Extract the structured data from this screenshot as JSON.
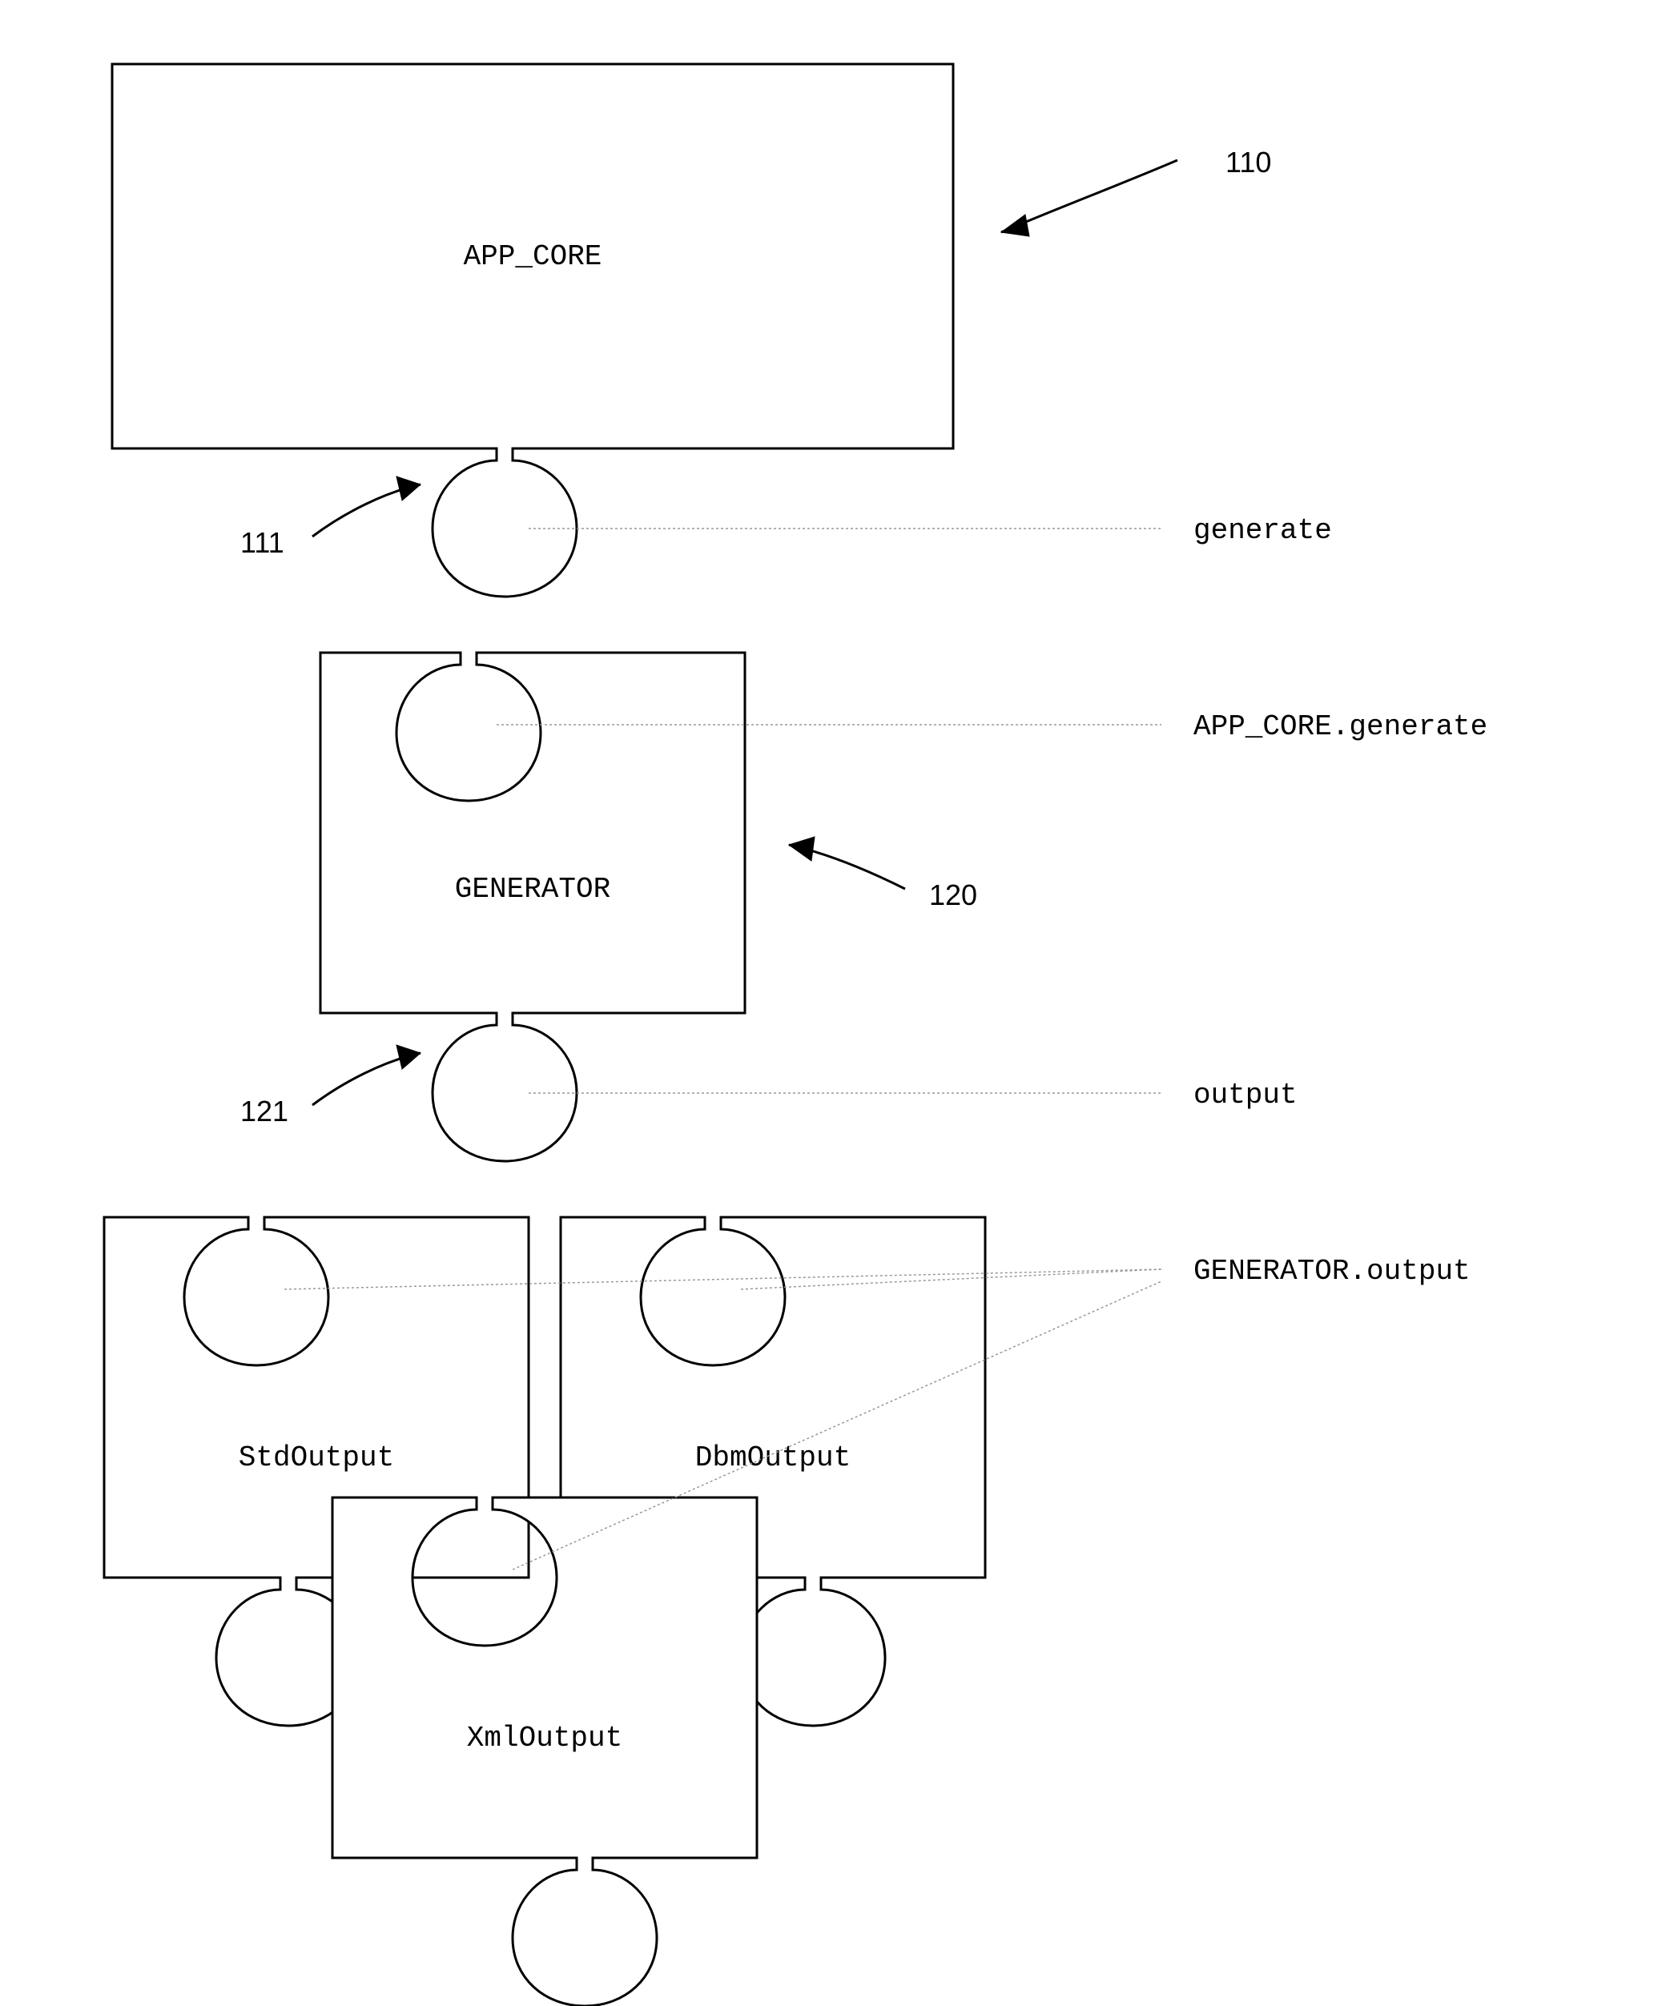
{
  "boxes": {
    "app_core": "APP_CORE",
    "generator": "GENERATOR",
    "std_output": "StdOutput",
    "xml_output": "XmlOutput",
    "dbm_output": "DbmOutput"
  },
  "labels": {
    "generate": "generate",
    "app_core_generate": "APP_CORE.generate",
    "output": "output",
    "generator_output": "GENERATOR.output"
  },
  "refs": {
    "r110": "110",
    "r111": "111",
    "r120": "120",
    "r121": "121"
  }
}
